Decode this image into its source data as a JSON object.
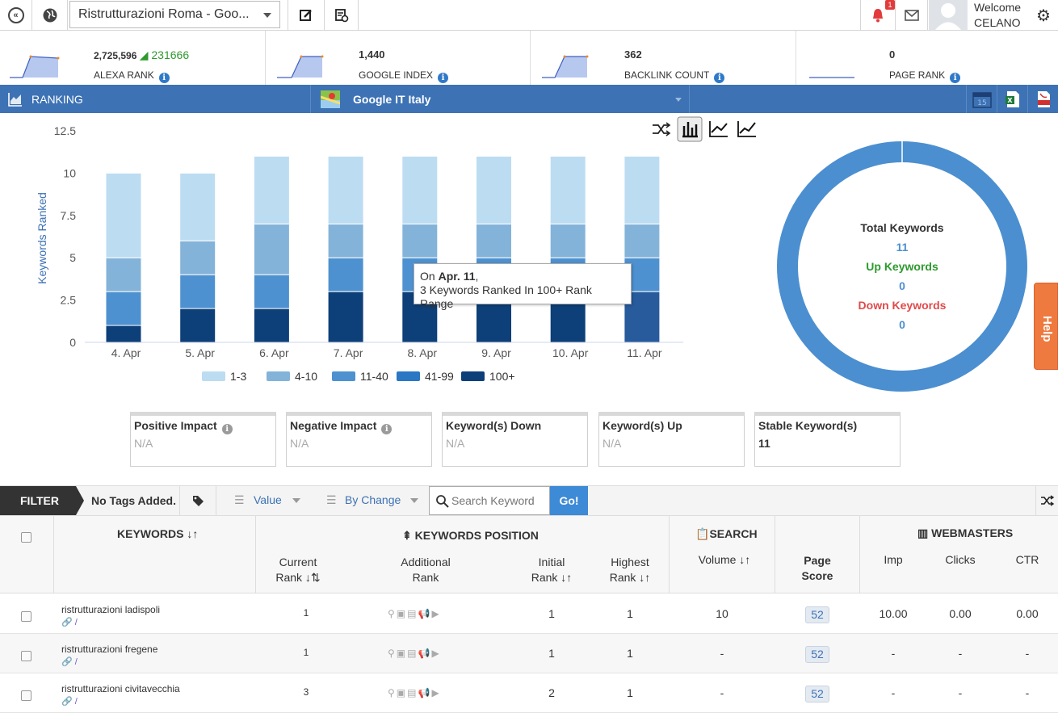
{
  "topbar": {
    "project": "Ristrutturazioni Roma - Goo...",
    "notif_count": "1",
    "welcome": "Welcome",
    "user": "CELANO"
  },
  "metrics": [
    {
      "value": "2,725,596",
      "delta": "231666",
      "label": "ALEXA RANK"
    },
    {
      "value": "1,440",
      "label": "GOOGLE INDEX"
    },
    {
      "value": "362",
      "label": "BACKLINK COUNT"
    },
    {
      "value": "0",
      "label": "PAGE RANK"
    }
  ],
  "rankbar": {
    "title": "RANKING",
    "engine": "Google IT Italy"
  },
  "colors": {
    "c1": "#bcdcf2",
    "c2": "#84b3d9",
    "c3": "#4e91d0",
    "c4": "#2a77c3",
    "c5": "#0d3f78",
    "accent": "#3d72b4",
    "green": "#2e9a2e",
    "red": "#e04a4a"
  },
  "chart_data": {
    "type": "bar",
    "ylabel": "Keywords Ranked",
    "ylim": [
      0,
      12.5
    ],
    "yticks": [
      "12.5",
      "10",
      "7.5",
      "5",
      "2.5",
      "0"
    ],
    "categories": [
      "4. Apr",
      "5. Apr",
      "6. Apr",
      "7. Apr",
      "8. Apr",
      "9. Apr",
      "10. Apr",
      "11. Apr"
    ],
    "stacked": true,
    "series": [
      {
        "name": "100+",
        "values": [
          1,
          2,
          2,
          3,
          3,
          3,
          3,
          3
        ]
      },
      {
        "name": "41-99",
        "values": [
          0,
          0,
          0,
          0,
          0,
          0,
          0,
          0
        ]
      },
      {
        "name": "11-40",
        "values": [
          2,
          2,
          2,
          2,
          2,
          2,
          2,
          2
        ]
      },
      {
        "name": "4-10",
        "values": [
          2,
          2,
          3,
          2,
          2,
          2,
          2,
          2
        ]
      },
      {
        "name": "1-3",
        "values": [
          5,
          4,
          4,
          4,
          4,
          4,
          4,
          4
        ]
      }
    ],
    "legend": [
      "1-3",
      "4-10",
      "11-40",
      "41-99",
      "100+"
    ],
    "tooltip": {
      "prefix": "On ",
      "date": "Apr. 11",
      "suffix": ",",
      "text": "3 Keywords Ranked In 100+ Rank Range"
    }
  },
  "donut": {
    "total_label": "Total Keywords",
    "total": "11",
    "up_label": "Up Keywords",
    "up": "0",
    "down_label": "Down Keywords",
    "down": "0"
  },
  "help": "Help",
  "impacts": [
    {
      "title": "Positive Impact",
      "value": "N/A",
      "info": true
    },
    {
      "title": "Negative Impact",
      "value": "N/A",
      "info": true
    },
    {
      "title": "Keyword(s) Down",
      "value": "N/A"
    },
    {
      "title": "Keyword(s) Up",
      "value": "N/A"
    },
    {
      "title": "Stable Keyword(s)",
      "value": "11"
    }
  ],
  "filter": {
    "label": "FILTER",
    "tags": "No Tags Added.",
    "value_dd": "Value",
    "change_dd": "By Change",
    "search_placeholder": "Search Keyword",
    "go": "Go!"
  },
  "table": {
    "keywords": "KEYWORDS",
    "position": "KEYWORDS POSITION",
    "current1": "Current",
    "current2": "Rank",
    "additional1": "Additional",
    "additional2": "Rank",
    "initial1": "Initial",
    "initial2": "Rank",
    "highest1": "Highest",
    "highest2": "Rank",
    "search": "SEARCH",
    "volume": "Volume",
    "page1": "Page",
    "page2": "Score",
    "webmasters": "WEBMASTERS",
    "imp": "Imp",
    "clicks": "Clicks",
    "ctr": "CTR",
    "rows": [
      {
        "kw": "ristrutturazioni ladispoli",
        "current": "1",
        "initial": "1",
        "highest": "1",
        "volume": "10",
        "score": "52",
        "imp": "10.00",
        "clicks": "0.00",
        "ctr": "0.00"
      },
      {
        "kw": "ristrutturazioni fregene",
        "current": "1",
        "initial": "1",
        "highest": "1",
        "volume": "-",
        "score": "52",
        "imp": "-",
        "clicks": "-",
        "ctr": "-"
      },
      {
        "kw": "ristrutturazioni civitavecchia",
        "current": "3",
        "initial": "2",
        "highest": "1",
        "volume": "-",
        "score": "52",
        "imp": "-",
        "clicks": "-",
        "ctr": "-"
      }
    ]
  }
}
